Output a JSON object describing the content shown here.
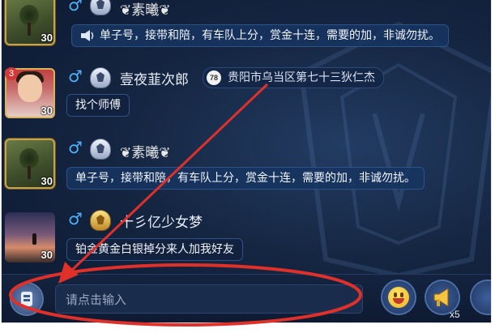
{
  "messages": [
    {
      "level": "30",
      "name": "❦素曦❦",
      "text": "单子号，接带和陪，有车队上分，赏金十连，需要的加，非诚勿扰。"
    },
    {
      "badge": "3",
      "level": "30",
      "name": "壹夜韮次郎",
      "location_icon": "78",
      "location": "贵阳市乌当区第七十三狄仁杰",
      "text": "找个师傅"
    },
    {
      "level": "30",
      "name": "❦素曦❦",
      "text": "单子号，接带和陪，有车队上分，赏金十连，需要的加，非诚勿扰。"
    },
    {
      "level": "30",
      "name": "十彡亿少女梦",
      "text": "铂金黄金白银掉分来人加我好友"
    }
  ],
  "input": {
    "placeholder": "请点击输入"
  },
  "horn_count": "x5",
  "icons": {
    "gender": "male-icon",
    "voice": "voice-icon",
    "emoji": "emoji-icon",
    "horn": "horn-icon",
    "speaker": "speaker-icon"
  },
  "colors": {
    "background": "#152642",
    "bubble": "#173460",
    "gender": "#4cb4ff",
    "annotation": "#e0302a"
  }
}
